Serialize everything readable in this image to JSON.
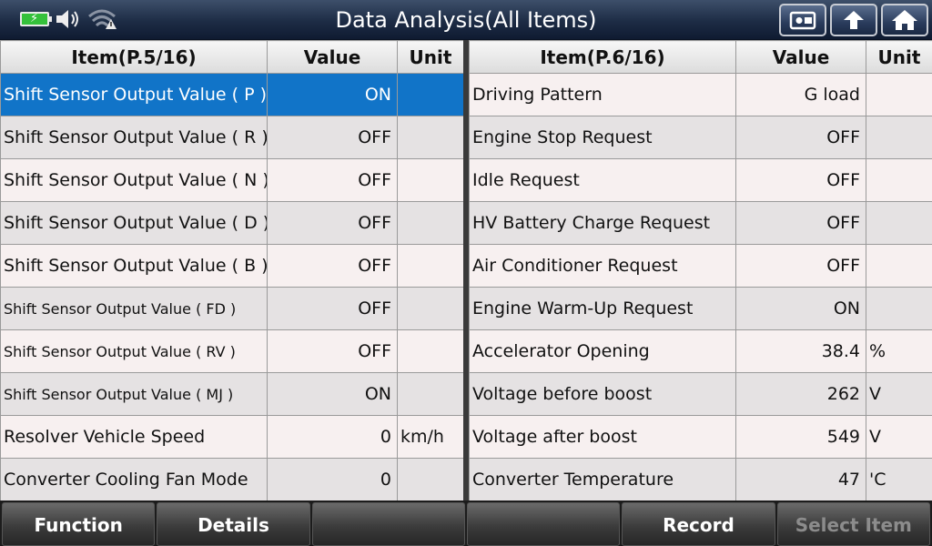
{
  "header": {
    "title": "Data Analysis(All Items)",
    "icons": [
      "battery-charging-icon",
      "speaker-icon",
      "wifi-warning-icon",
      "screenshot-icon",
      "back-icon",
      "home-icon"
    ]
  },
  "left_table": {
    "headers": {
      "item": "Item(P.5/16)",
      "value": "Value",
      "unit": "Unit"
    },
    "rows": [
      {
        "item": "Shift Sensor Output Value ( P )",
        "value": "ON",
        "unit": ""
      },
      {
        "item": "Shift Sensor Output Value ( R )",
        "value": "OFF",
        "unit": ""
      },
      {
        "item": "Shift Sensor Output Value ( N )",
        "value": "OFF",
        "unit": ""
      },
      {
        "item": "Shift Sensor Output Value ( D )",
        "value": "OFF",
        "unit": ""
      },
      {
        "item": "Shift Sensor Output Value ( B )",
        "value": "OFF",
        "unit": ""
      },
      {
        "item": "Shift Sensor Output Value ( FD )",
        "value": "OFF",
        "unit": ""
      },
      {
        "item": "Shift Sensor Output Value ( RV )",
        "value": "OFF",
        "unit": ""
      },
      {
        "item": "Shift Sensor Output Value ( MJ )",
        "value": "ON",
        "unit": ""
      },
      {
        "item": "Resolver Vehicle Speed",
        "value": "0",
        "unit": "km/h"
      },
      {
        "item": "Converter Cooling Fan Mode",
        "value": "0",
        "unit": ""
      }
    ]
  },
  "right_table": {
    "headers": {
      "item": "Item(P.6/16)",
      "value": "Value",
      "unit": "Unit"
    },
    "rows": [
      {
        "item": "Driving Pattern",
        "value": "G load",
        "unit": ""
      },
      {
        "item": "Engine Stop Request",
        "value": "OFF",
        "unit": ""
      },
      {
        "item": "Idle Request",
        "value": "OFF",
        "unit": ""
      },
      {
        "item": "HV Battery Charge Request",
        "value": "OFF",
        "unit": ""
      },
      {
        "item": "Air Conditioner Request",
        "value": "OFF",
        "unit": ""
      },
      {
        "item": "Engine Warm-Up Request",
        "value": "ON",
        "unit": ""
      },
      {
        "item": "Accelerator Opening",
        "value": "38.4",
        "unit": "%"
      },
      {
        "item": "Voltage before boost",
        "value": "262",
        "unit": "V"
      },
      {
        "item": "Voltage after boost",
        "value": "549",
        "unit": "V"
      },
      {
        "item": "Converter Temperature",
        "value": "47",
        "unit": "'C"
      }
    ]
  },
  "toolbar": {
    "buttons": [
      "Function",
      "Details",
      "",
      "",
      "Record",
      "Select Item"
    ]
  },
  "colors": {
    "header_bg": "#1d2c45",
    "selected_row": "#1174c8",
    "battery": "#35c13b"
  }
}
